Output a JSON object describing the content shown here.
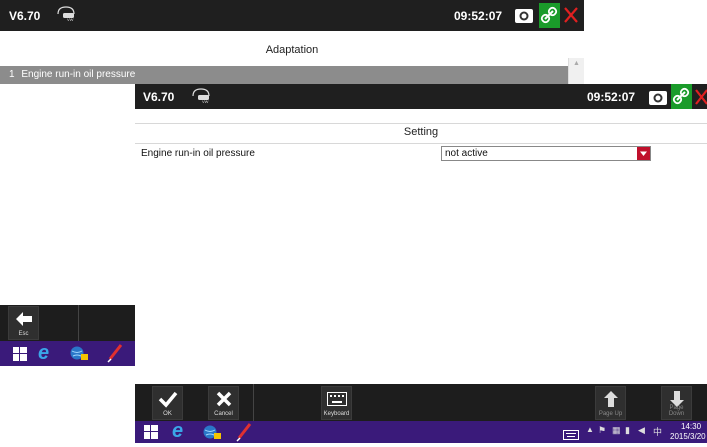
{
  "back_window": {
    "version": "V6.70",
    "time": "09:52:07",
    "title": "Adaptation",
    "list_items": [
      {
        "index": "1",
        "label": "Engine run-in oil pressure"
      }
    ],
    "esc_label": "Esc"
  },
  "front_window": {
    "version": "V6.70",
    "time": "09:52:07",
    "title": "Setting",
    "setting_label": "Engine run-in oil pressure",
    "setting_value": "not active",
    "toolbar": {
      "ok_label": "OK",
      "cancel_label": "Cancel",
      "keyboard_label": "Keyboard",
      "page_up_label": "Page Up",
      "page_down_label": "Page Down"
    }
  },
  "taskbar": {
    "time": "14:30",
    "date": "2015/3/20"
  },
  "colors": {
    "topbar": "#1f1f1f",
    "taskbar": "#3a1a7a",
    "link_icon": "#1a9b2a",
    "close_icon": "#e02020",
    "dropdown_arrow": "#c0102c",
    "selected_row": "#8c8c8c"
  },
  "icons": [
    "car-logo-icon",
    "camera-icon",
    "link-icon",
    "close-icon",
    "back-arrow-icon",
    "checkmark-icon",
    "x-icon",
    "keyboard-icon",
    "up-arrow-icon",
    "down-arrow-icon",
    "windows-start-icon",
    "ie-icon",
    "globe-icon",
    "pen-icon"
  ]
}
